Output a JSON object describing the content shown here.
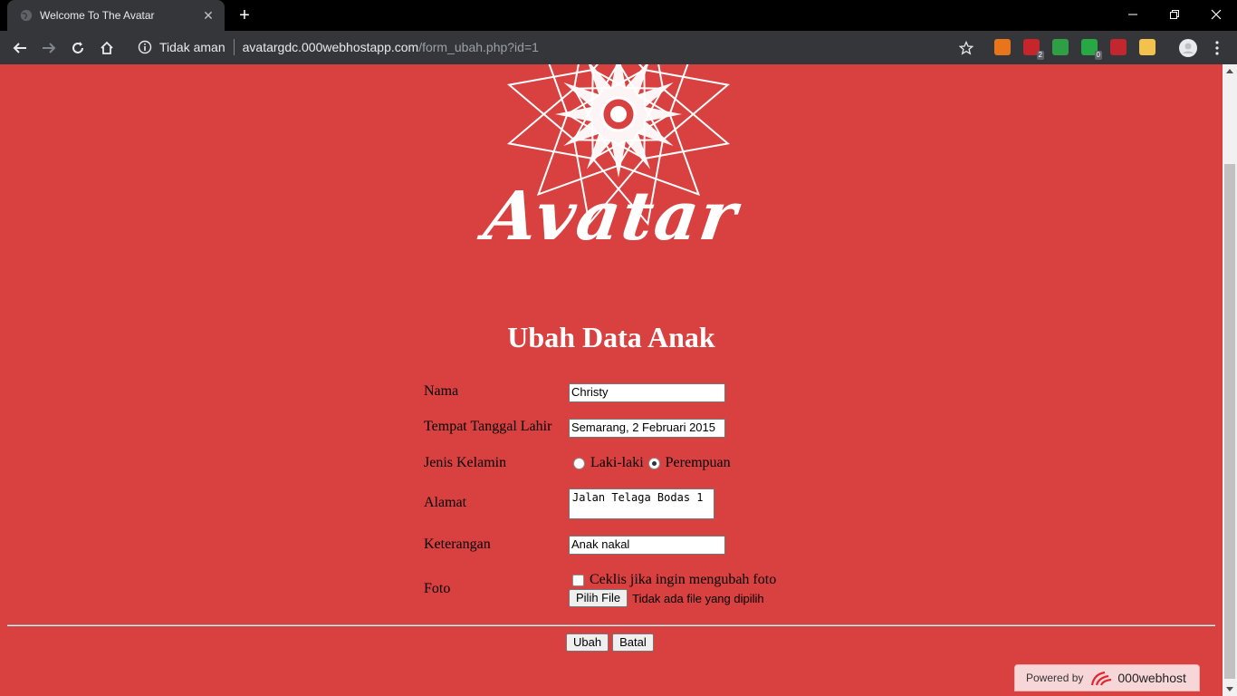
{
  "browser": {
    "tab_title": "Welcome To The Avatar",
    "security_label": "Tidak aman",
    "url_host": "avatargdc.000webhostapp.com",
    "url_path": "/form_ubah.php?id=1",
    "extensions": [
      {
        "name": "fire-extension-icon",
        "color": "#e8741c",
        "badge": ""
      },
      {
        "name": "adblock-extension-icon",
        "color": "#c5252b",
        "badge": "2"
      },
      {
        "name": "colorful-extension-icon",
        "color": "#2f9e44",
        "badge": ""
      },
      {
        "name": "shield-extension-icon",
        "color": "#28a745",
        "badge": "0"
      },
      {
        "name": "m-extension-icon",
        "color": "#c2262e",
        "badge": ""
      },
      {
        "name": "pill-extension-icon",
        "color": "#f2c14e",
        "badge": ""
      }
    ]
  },
  "page": {
    "logo_text": "Avatar",
    "heading": "Ubah Data Anak",
    "form": {
      "nama_label": "Nama",
      "nama_value": "Christy",
      "ttl_label": "Tempat Tanggal Lahir",
      "ttl_value": "Semarang, 2 Februari 2015",
      "jk_label": "Jenis Kelamin",
      "jk_option_male": "Laki-laki",
      "jk_option_female": "Perempuan",
      "jk_selected": "Perempuan",
      "alamat_label": "Alamat",
      "alamat_value": "Jalan Telaga Bodas 1",
      "keterangan_label": "Keterangan",
      "keterangan_value": "Anak nakal",
      "foto_label": "Foto",
      "foto_checkbox_label": "Ceklis jika ingin mengubah foto",
      "file_button": "Pilih File",
      "file_status": "Tidak ada file yang dipilih",
      "submit_button": "Ubah",
      "cancel_button": "Batal"
    },
    "powered_by_label": "Powered by",
    "powered_by_brand": "000webhost"
  },
  "colors": {
    "page_bg": "#d94040",
    "chrome_dark": "#35363a"
  }
}
